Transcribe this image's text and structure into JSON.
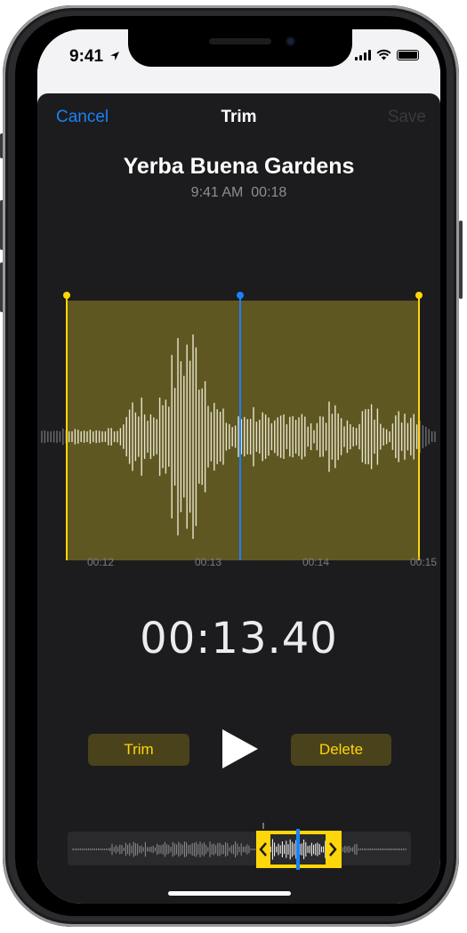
{
  "status_bar": {
    "time": "9:41"
  },
  "nav": {
    "cancel_label": "Cancel",
    "title": "Trim",
    "save_label": "Save"
  },
  "recording": {
    "title": "Yerba Buena Gardens",
    "time": "9:41 AM",
    "duration": "00:18"
  },
  "timeline": {
    "ticks": [
      "00:12",
      "00:13",
      "00:14",
      "00:15"
    ]
  },
  "playback": {
    "elapsed": "00:13.40"
  },
  "actions": {
    "trim_label": "Trim",
    "delete_label": "Delete"
  },
  "colors": {
    "accent": "#1a82f7",
    "trim_yellow": "#ffd60a",
    "selection_fill": "#5f5721",
    "background": "#1c1c1e"
  },
  "icons": [
    "location-arrow-icon",
    "signal-icon",
    "wifi-icon",
    "battery-icon",
    "play-icon",
    "chevron-left-icon",
    "chevron-right-icon"
  ]
}
